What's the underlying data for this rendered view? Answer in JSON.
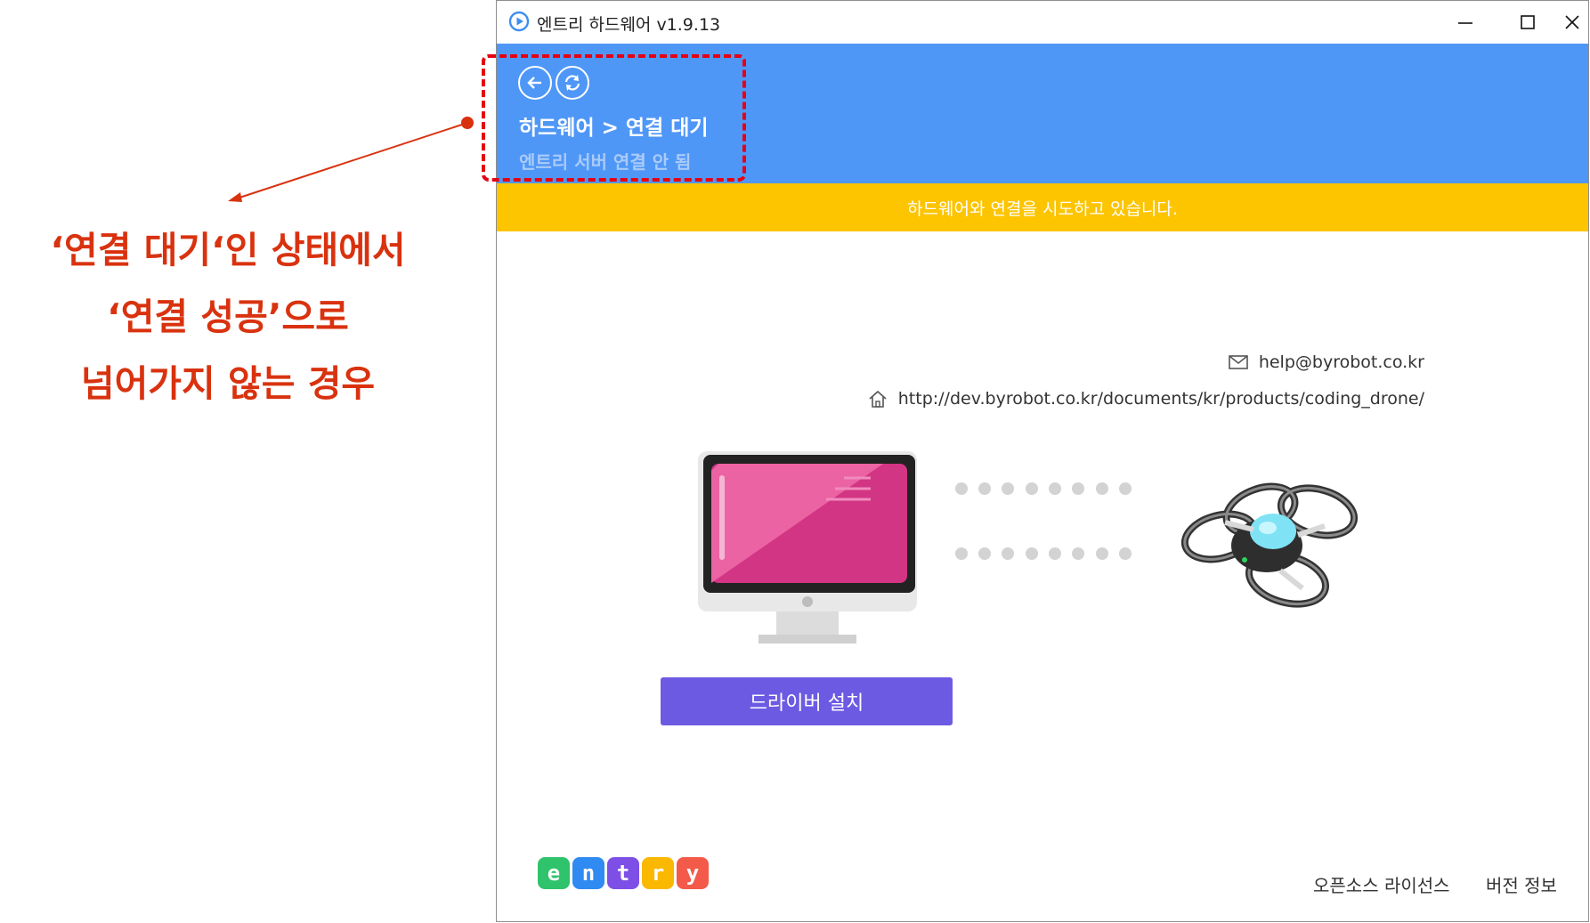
{
  "annotation": {
    "lines": [
      "‘연결 대기‘인 상태에서",
      "‘연결 성공’으로",
      "넘어가지 않는 경우"
    ]
  },
  "window": {
    "title": "엔트리 하드웨어 v1.9.13"
  },
  "header": {
    "breadcrumb": "하드웨어 > 연결 대기",
    "server_status": "엔트리 서버 연결 안 됨"
  },
  "status_bar": {
    "message": "하드웨어와 연결을 시도하고 있습니다."
  },
  "contact": {
    "email": "help@byrobot.co.kr",
    "homepage": "http://dev.byrobot.co.kr/documents/kr/products/coding_drone/"
  },
  "driver_button": {
    "label": "드라이버 설치"
  },
  "logo": {
    "letters": [
      "e",
      "n",
      "t",
      "r",
      "y"
    ]
  },
  "footer": {
    "license": "오픈소스 라이선스",
    "version_info": "버전 정보"
  },
  "colors": {
    "header_blue": "#4f97f7",
    "status_yellow": "#fdc400",
    "button_purple": "#6d5ae3",
    "annotation_red": "#d9320f"
  }
}
